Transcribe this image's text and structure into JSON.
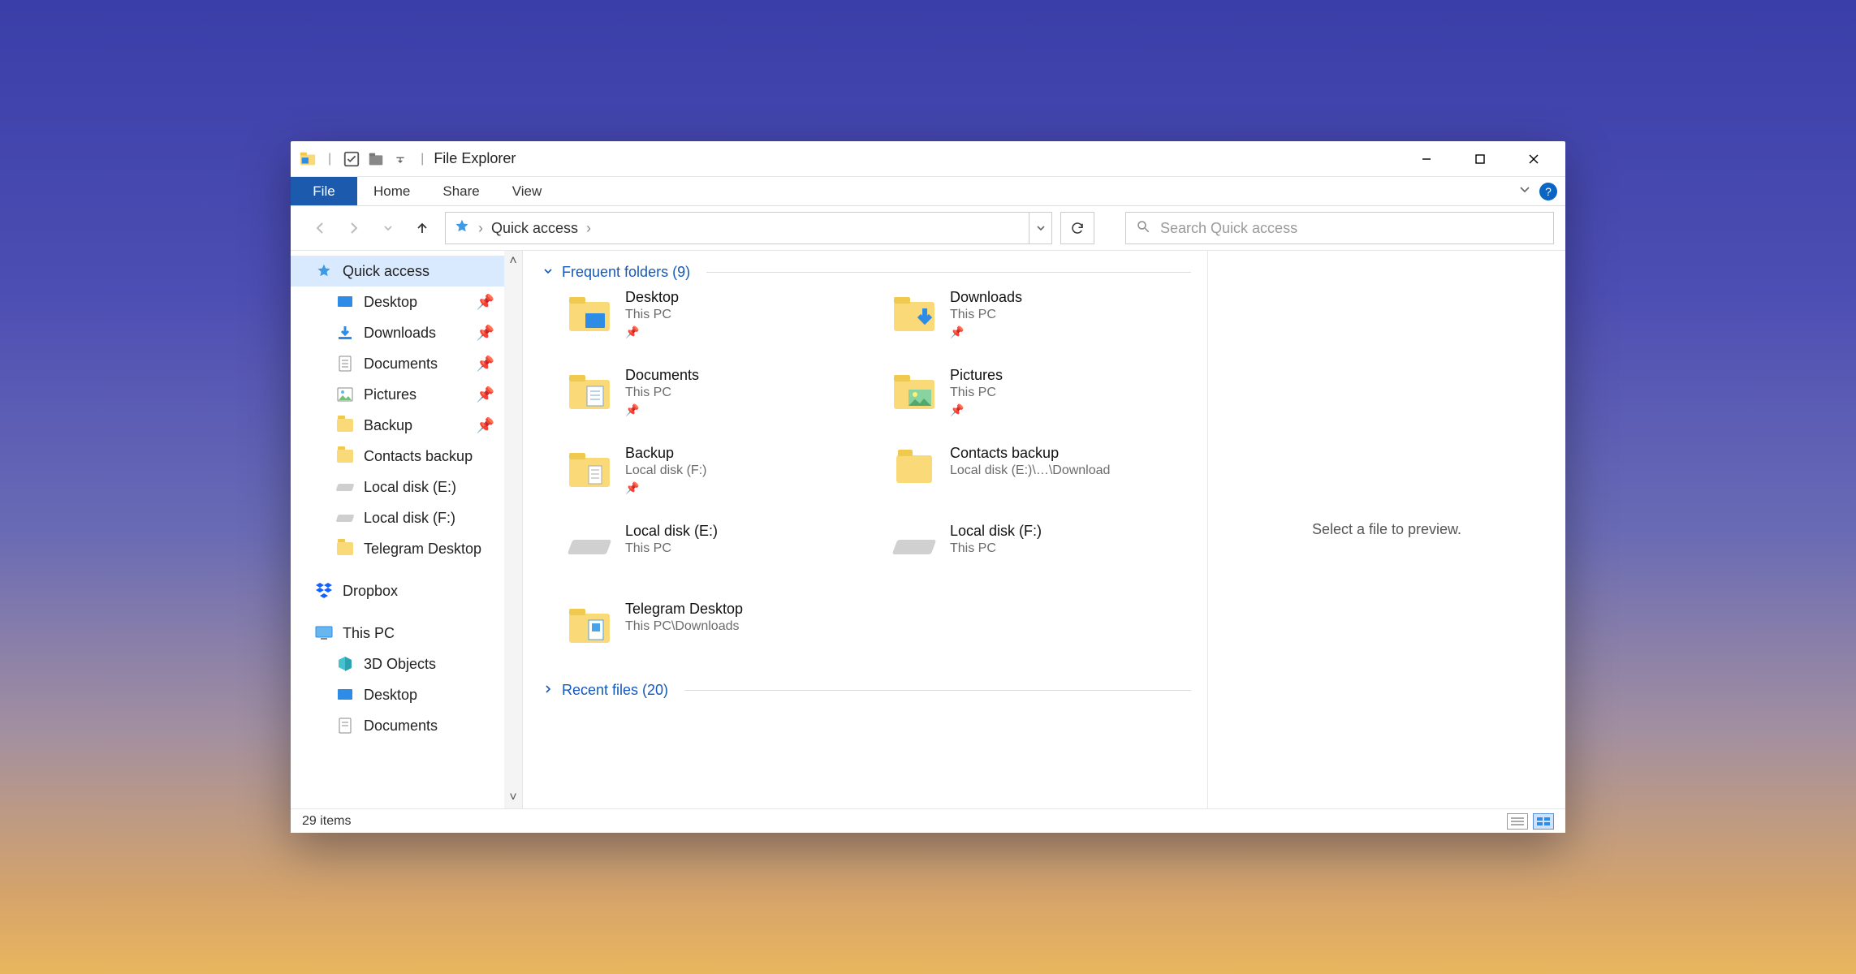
{
  "window": {
    "title": "File Explorer"
  },
  "ribbon": {
    "file": "File",
    "home": "Home",
    "share": "Share",
    "view": "View"
  },
  "nav": {
    "breadcrumb_root": "Quick access",
    "search_placeholder": "Search Quick access"
  },
  "tree": {
    "quick_access": "Quick access",
    "desktop": "Desktop",
    "downloads": "Downloads",
    "documents": "Documents",
    "pictures": "Pictures",
    "backup": "Backup",
    "contacts_backup": "Contacts backup",
    "local_e": "Local disk (E:)",
    "local_f": "Local disk (F:)",
    "telegram": "Telegram Desktop",
    "dropbox": "Dropbox",
    "this_pc": "This PC",
    "3d_objects": "3D Objects",
    "desktop2": "Desktop",
    "documents2": "Documents"
  },
  "sections": {
    "frequent_label": "Frequent folders (9)",
    "recent_label": "Recent files (20)"
  },
  "tiles": {
    "desktop": {
      "name": "Desktop",
      "loc": "This PC",
      "pinned": true
    },
    "downloads": {
      "name": "Downloads",
      "loc": "This PC",
      "pinned": true
    },
    "documents": {
      "name": "Documents",
      "loc": "This PC",
      "pinned": true
    },
    "pictures": {
      "name": "Pictures",
      "loc": "This PC",
      "pinned": true
    },
    "backup": {
      "name": "Backup",
      "loc": "Local disk (F:)",
      "pinned": true
    },
    "contacts_backup": {
      "name": "Contacts backup",
      "loc": "Local disk (E:)\\…\\Download",
      "pinned": false
    },
    "local_e": {
      "name": "Local disk (E:)",
      "loc": "This PC",
      "pinned": false
    },
    "local_f": {
      "name": "Local disk (F:)",
      "loc": "This PC",
      "pinned": false
    },
    "telegram": {
      "name": "Telegram Desktop",
      "loc": "This PC\\Downloads",
      "pinned": false
    }
  },
  "preview": {
    "empty_text": "Select a file to preview."
  },
  "status": {
    "item_count_text": "29 items"
  },
  "glyphs": {
    "pin": "📌"
  }
}
